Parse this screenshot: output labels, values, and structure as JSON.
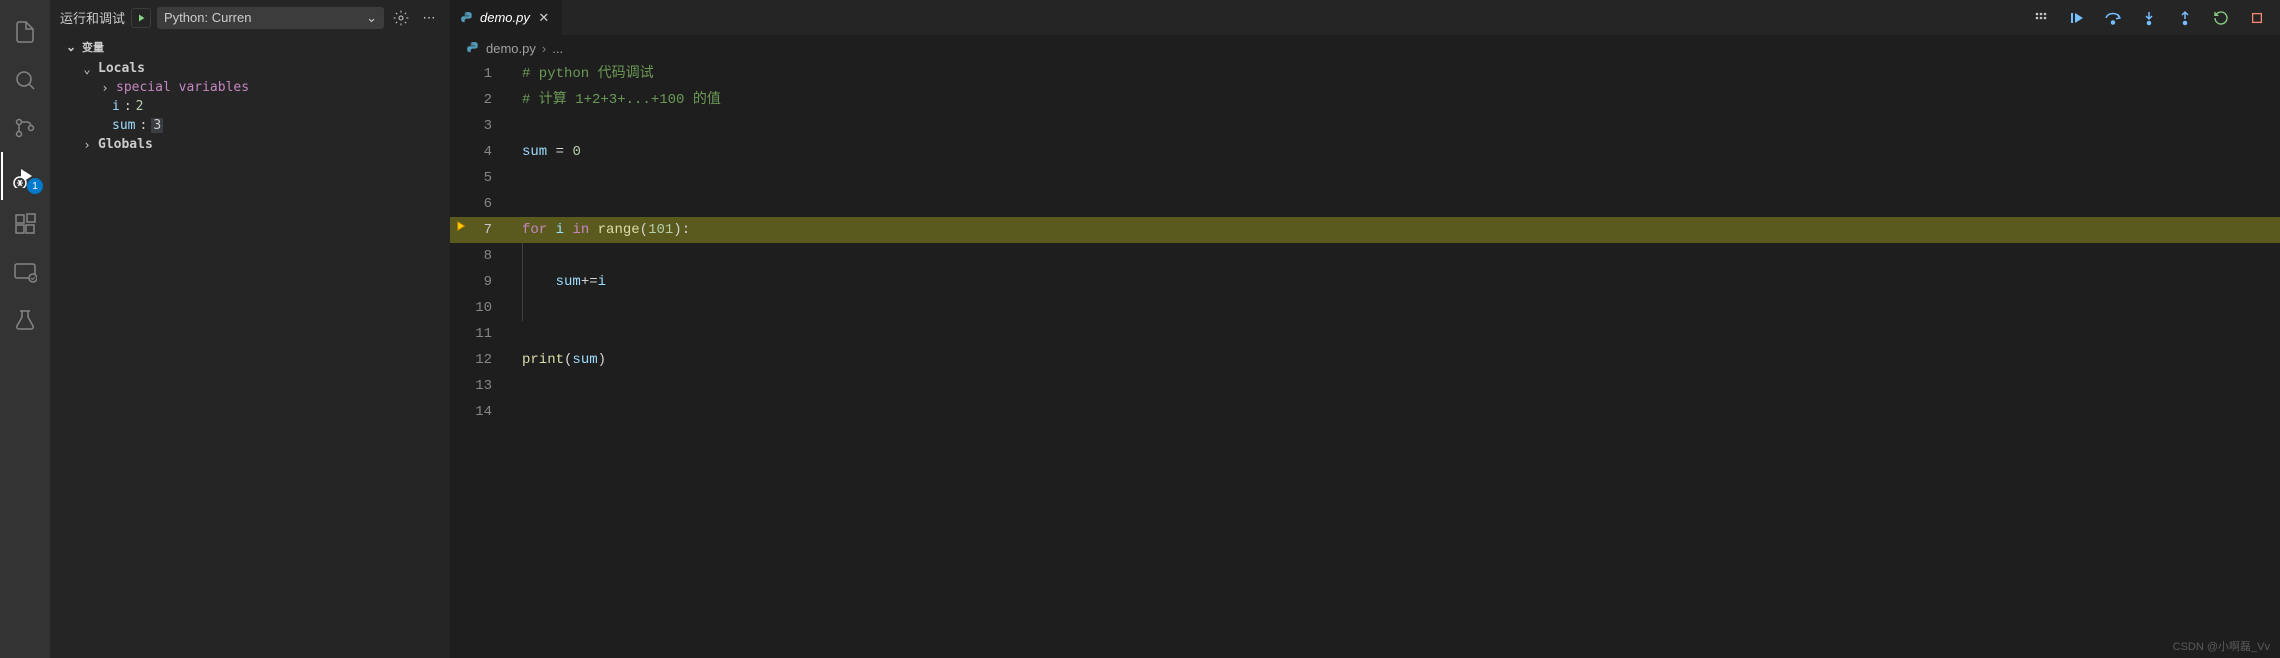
{
  "activity_bar_badge": "1",
  "debug_panel": {
    "title": "运行和调试",
    "config": "Python: Curren",
    "variables_header": "变量",
    "locals_label": "Locals",
    "globals_label": "Globals",
    "special_vars_label": "special variables",
    "var_i_name": "i",
    "var_i_value": "2",
    "var_sum_name": "sum",
    "var_sum_value": "3"
  },
  "tab": {
    "filename": "demo.py"
  },
  "breadcrumbs": {
    "filename": "demo.py",
    "sep": "›",
    "tail": "..."
  },
  "code": {
    "l1_comment": "# python 代码调试",
    "l2_comment": "# 计算 1+2+3+...+100 的值",
    "l4_sum": "sum",
    "l4_eq": " = ",
    "l4_zero": "0",
    "l7_for": "for",
    "l7_i": " i ",
    "l7_in": "in",
    "l7_sp": " ",
    "l7_range": "range",
    "l7_lp": "(",
    "l7_101": "101",
    "l7_rp": ")",
    "l7_colon": ":",
    "l9_indent": "    ",
    "l9_sum": "sum",
    "l9_op": "+=",
    "l9_i": "i",
    "l12_print": "print",
    "l12_lp": "(",
    "l12_sum": "sum",
    "l12_rp": ")"
  },
  "line_numbers": [
    "1",
    "2",
    "3",
    "4",
    "5",
    "6",
    "7",
    "8",
    "9",
    "10",
    "11",
    "12",
    "13",
    "14"
  ],
  "watermark": "CSDN @小啊磊_Vv"
}
